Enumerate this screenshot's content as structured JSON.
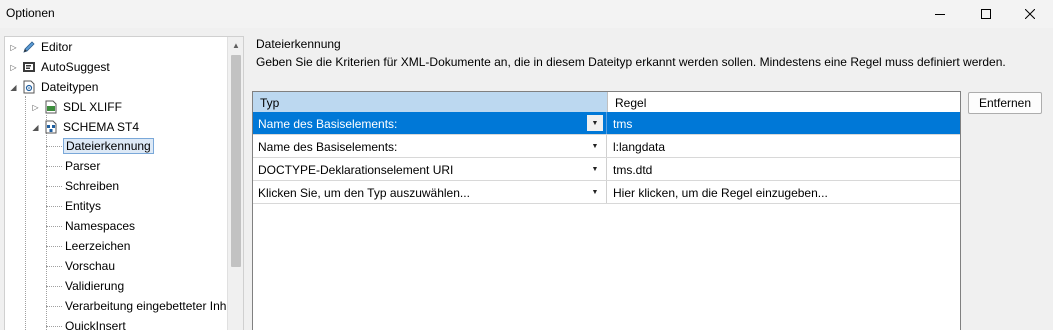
{
  "window": {
    "title": "Optionen"
  },
  "tree": {
    "items": [
      {
        "label": "Editor"
      },
      {
        "label": "AutoSuggest"
      },
      {
        "label": "Dateitypen"
      },
      {
        "label": "SDL XLIFF"
      },
      {
        "label": "SCHEMA ST4"
      },
      {
        "label": "Dateierkennung"
      },
      {
        "label": "Parser"
      },
      {
        "label": "Schreiben"
      },
      {
        "label": "Entitys"
      },
      {
        "label": "Namespaces"
      },
      {
        "label": "Leerzeichen"
      },
      {
        "label": "Vorschau"
      },
      {
        "label": "Validierung"
      },
      {
        "label": "Verarbeitung eingebetteter Inh"
      },
      {
        "label": "QuickInsert"
      }
    ]
  },
  "section": {
    "title": "Dateierkennung",
    "description": "Geben Sie die Kriterien für XML-Dokumente an, die in diesem Dateityp erkannt werden sollen. Mindestens eine Regel muss definiert werden."
  },
  "grid": {
    "columns": [
      "Typ",
      "Regel"
    ],
    "rows": [
      {
        "type": "Name des Basiselements:",
        "rule": "tms"
      },
      {
        "type": "Name des Basiselements:",
        "rule": "l:langdata"
      },
      {
        "type": "DOCTYPE-Deklarationselement URI",
        "rule": "tms.dtd"
      },
      {
        "type": "Klicken Sie, um den Typ auszuwählen...",
        "rule": "Hier klicken, um die Regel einzugeben..."
      }
    ],
    "selected_row": 0
  },
  "buttons": {
    "remove": "Entfernen"
  },
  "colors": {
    "selection": "#0078d7",
    "header_highlight": "#bcd8f0"
  }
}
